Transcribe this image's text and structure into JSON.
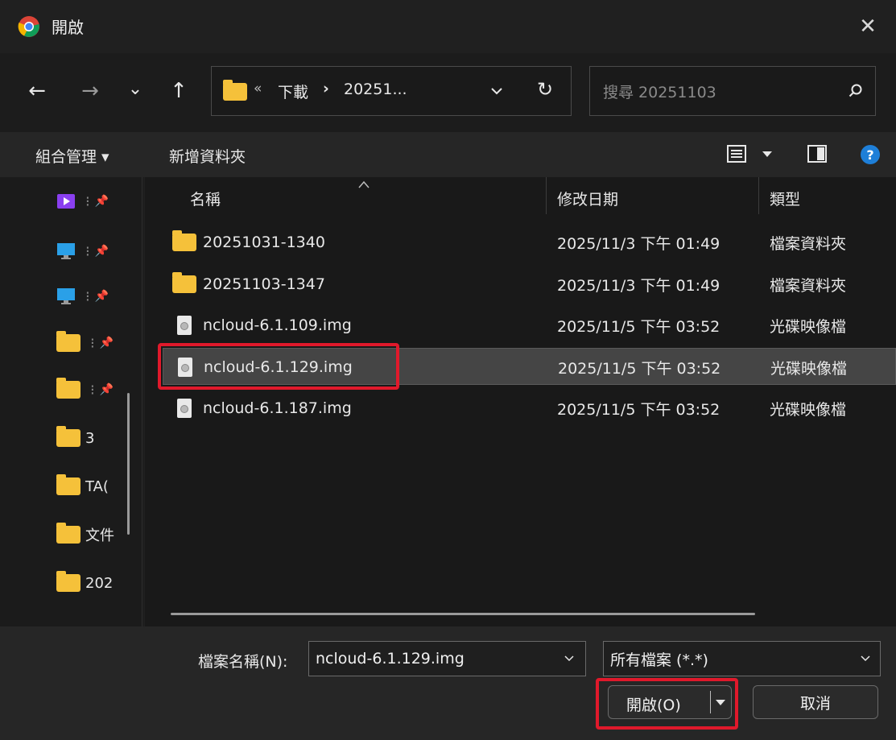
{
  "window": {
    "title": "開啟",
    "close": "✕"
  },
  "nav": {
    "back": "←",
    "forward": "→",
    "recent": "⌄",
    "up": "↑",
    "address": {
      "prefix": "«",
      "segments": [
        "下載",
        "20251..."
      ],
      "separator": "›"
    },
    "refresh": "↻",
    "search_placeholder": "搜尋 20251103"
  },
  "toolbar": {
    "organize": "組合管理 ▾",
    "new_folder": "新增資料夾"
  },
  "navpane": {
    "items": [
      {
        "icon": "video-icon",
        "label": "",
        "pinned": true
      },
      {
        "icon": "desktop-icon",
        "label": "",
        "pinned": true
      },
      {
        "icon": "desktop-icon",
        "label": "",
        "pinned": true
      },
      {
        "icon": "folder-icon",
        "label": "",
        "pinned": true
      },
      {
        "icon": "folder-icon",
        "label": "",
        "pinned": true
      },
      {
        "icon": "folder-icon",
        "label": "3",
        "pinned": false
      },
      {
        "icon": "folder-icon",
        "label": "TA(",
        "pinned": false
      },
      {
        "icon": "folder-icon",
        "label": "文件",
        "pinned": false
      },
      {
        "icon": "folder-icon",
        "label": "202",
        "pinned": false
      }
    ]
  },
  "filelist": {
    "columns": {
      "name": "名稱",
      "modified": "修改日期",
      "type": "類型"
    },
    "rows": [
      {
        "icon": "folder-icon",
        "name": "20251031-1340",
        "modified": "2025/11/3 下午 01:49",
        "type": "檔案資料夾",
        "selected": false
      },
      {
        "icon": "folder-icon",
        "name": "20251103-1347",
        "modified": "2025/11/3 下午 01:49",
        "type": "檔案資料夾",
        "selected": false
      },
      {
        "icon": "disc-image-icon",
        "name": "ncloud-6.1.109.img",
        "modified": "2025/11/5 下午 03:52",
        "type": "光碟映像檔",
        "selected": false
      },
      {
        "icon": "disc-image-icon",
        "name": "ncloud-6.1.129.img",
        "modified": "2025/11/5 下午 03:52",
        "type": "光碟映像檔",
        "selected": true
      },
      {
        "icon": "disc-image-icon",
        "name": "ncloud-6.1.187.img",
        "modified": "2025/11/5 下午 03:52",
        "type": "光碟映像檔",
        "selected": false
      }
    ]
  },
  "bottom": {
    "filename_label": "檔案名稱(N):",
    "filename_value": "ncloud-6.1.129.img",
    "filetype_value": "所有檔案 (*.*)",
    "open_button": "開啟(O)",
    "cancel_button": "取消"
  },
  "colors": {
    "highlight": "#e0192b",
    "help": "#1e7fd8",
    "folder": "#f5c13a"
  }
}
